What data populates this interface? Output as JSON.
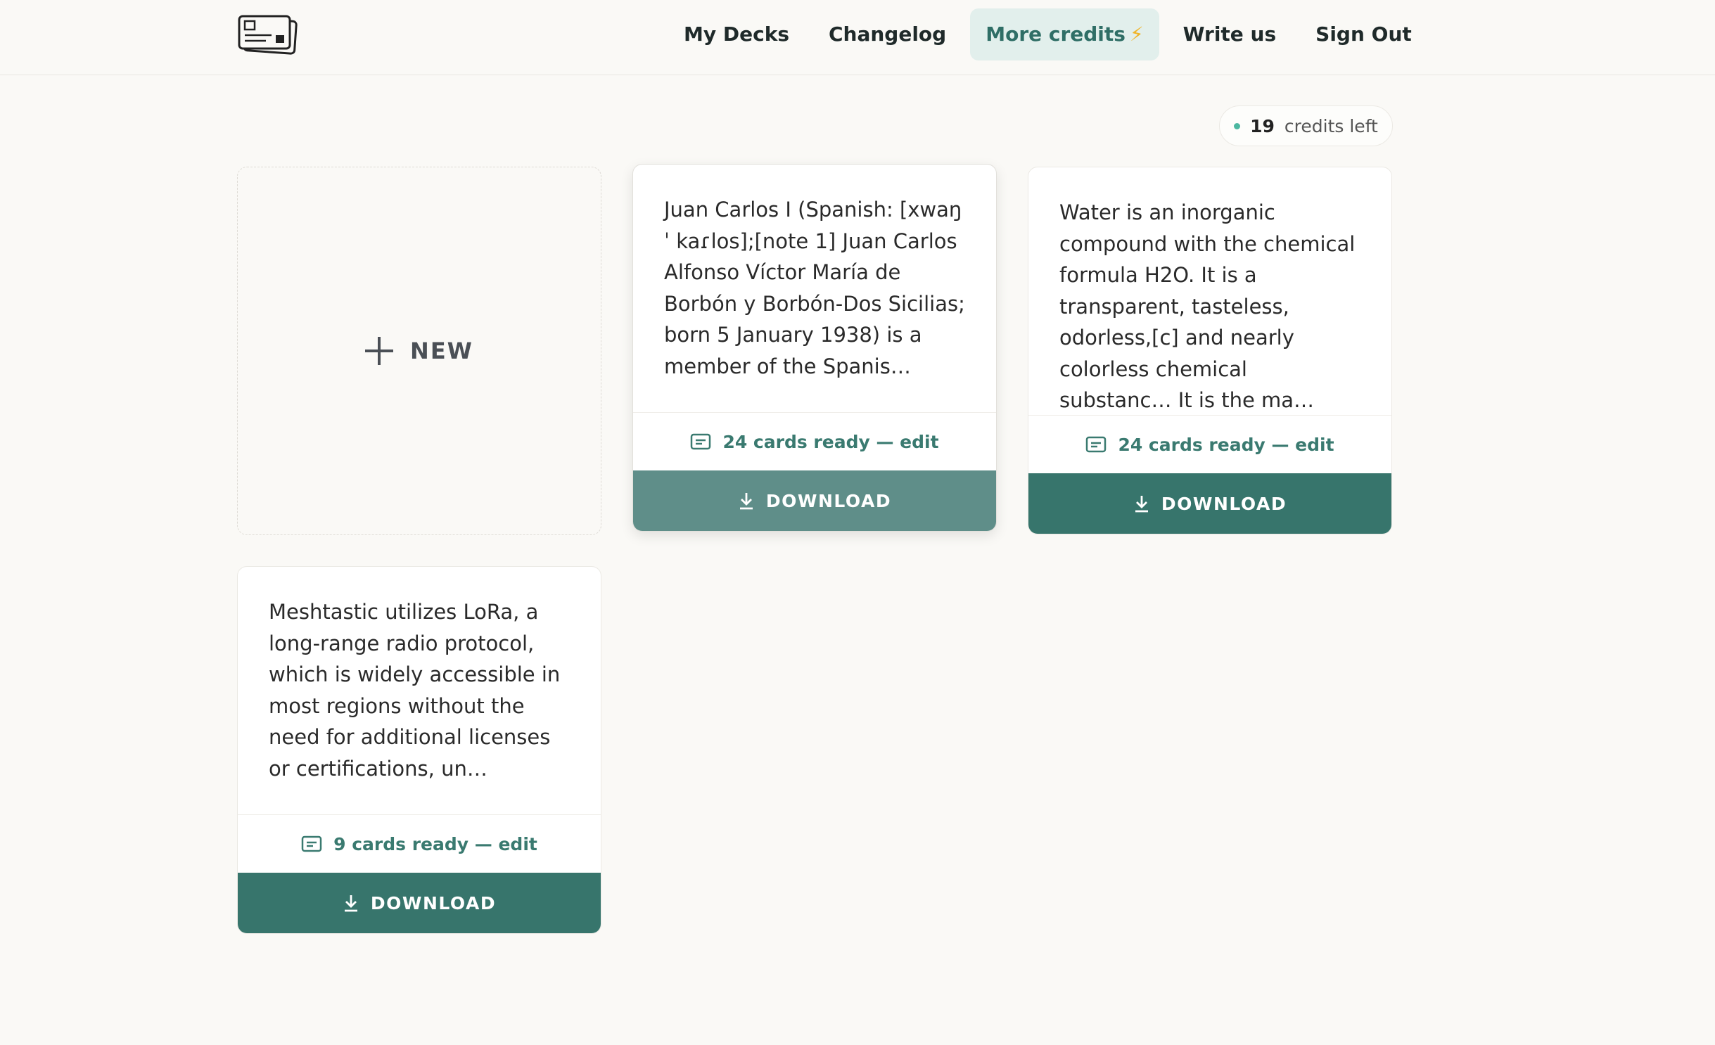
{
  "header": {
    "logo_icon": "flashcards-logo-icon",
    "nav": [
      {
        "label": "My Decks"
      },
      {
        "label": "Changelog"
      },
      {
        "label": "More credits",
        "icon": "⚡",
        "active": true
      },
      {
        "label": "Write us"
      },
      {
        "label": "Sign Out"
      }
    ]
  },
  "credits": {
    "count": "19",
    "label": "credits left"
  },
  "new_card": {
    "label": "NEW"
  },
  "decks": [
    {
      "text": "Juan Carlos I (Spanish: [xwaŋˈ kaɾlos];[note 1] Juan Carlos Alfonso Víctor María de Borbón y Borbón-Dos Sicilias; born 5 January 1938) is a member of the Spanis…",
      "meta": "24 cards ready — edit",
      "download": "DOWNLOAD"
    },
    {
      "text": "Water is an inorganic compound with the chemical formula H2O. It is a transparent, tasteless, odorless,[c] and nearly colorless chemical substanc… It is the ma…",
      "meta": "24 cards ready — edit",
      "download": "DOWNLOAD"
    },
    {
      "text": "Meshtastic utilizes LoRa, a long-range radio protocol, which is widely accessible in most regions without the need for additional licenses or certifications, un…",
      "meta": "9 cards ready — edit",
      "download": "DOWNLOAD"
    }
  ],
  "colors": {
    "accent": "#37756c",
    "accent_hover": "#5f8e89",
    "active_nav_bg": "#e2efec",
    "background": "#faf9f6"
  }
}
